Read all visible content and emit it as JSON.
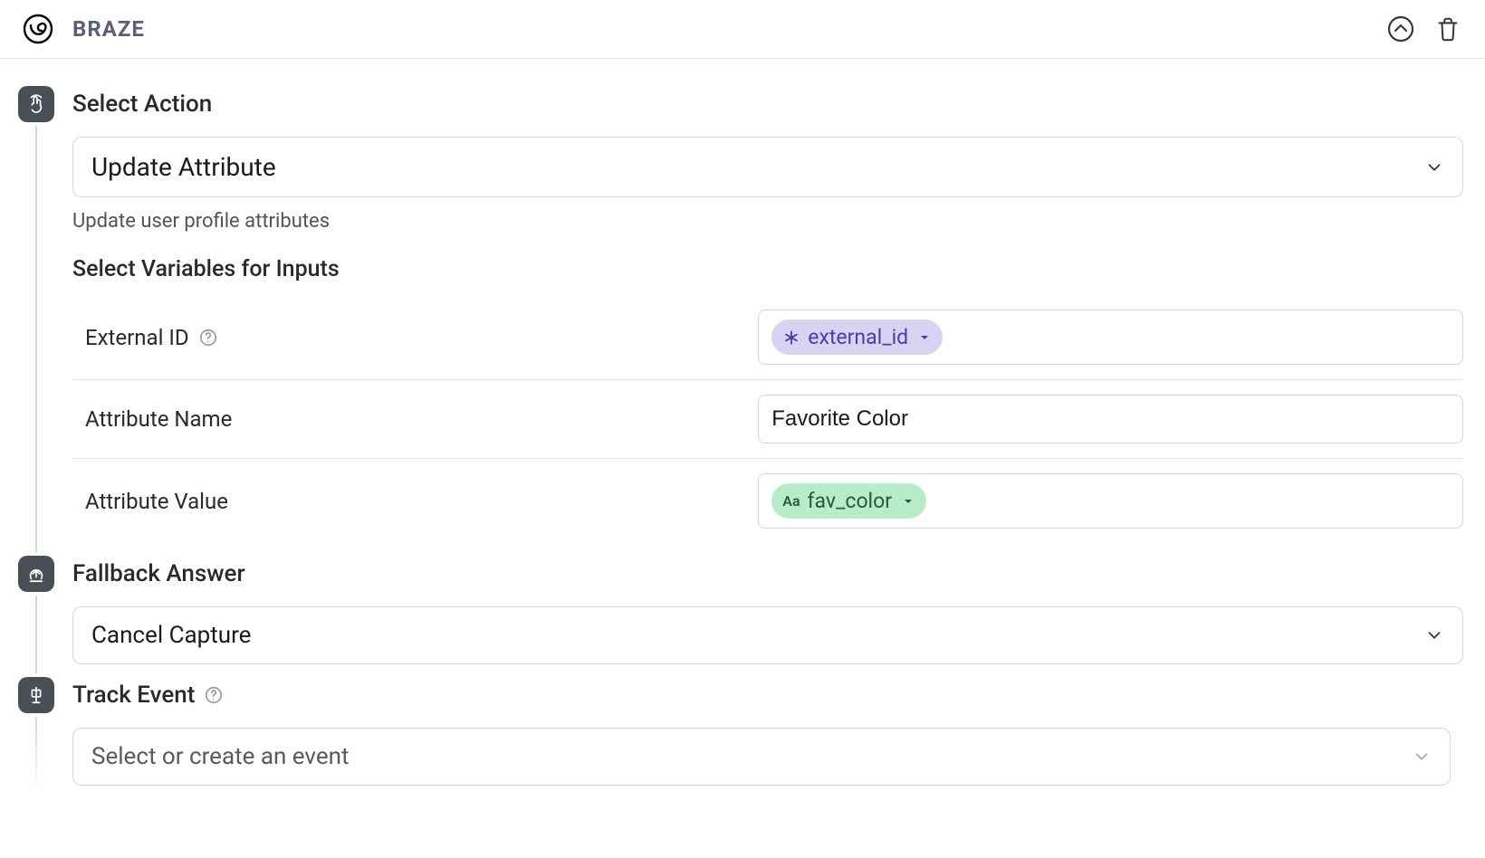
{
  "brand": {
    "name": "BRAZE"
  },
  "sections": {
    "action": {
      "title": "Select Action",
      "selected": "Update Attribute",
      "description": "Update user profile attributes",
      "vars_header": "Select Variables for Inputs",
      "rows": {
        "external_id": {
          "label": "External ID",
          "chip": "external_id"
        },
        "attr_name": {
          "label": "Attribute Name",
          "value": "Favorite Color"
        },
        "attr_value": {
          "label": "Attribute Value",
          "chip": "fav_color"
        }
      }
    },
    "fallback": {
      "title": "Fallback Answer",
      "selected": "Cancel Capture"
    },
    "track": {
      "title": "Track Event",
      "placeholder": "Select or create an event"
    }
  }
}
